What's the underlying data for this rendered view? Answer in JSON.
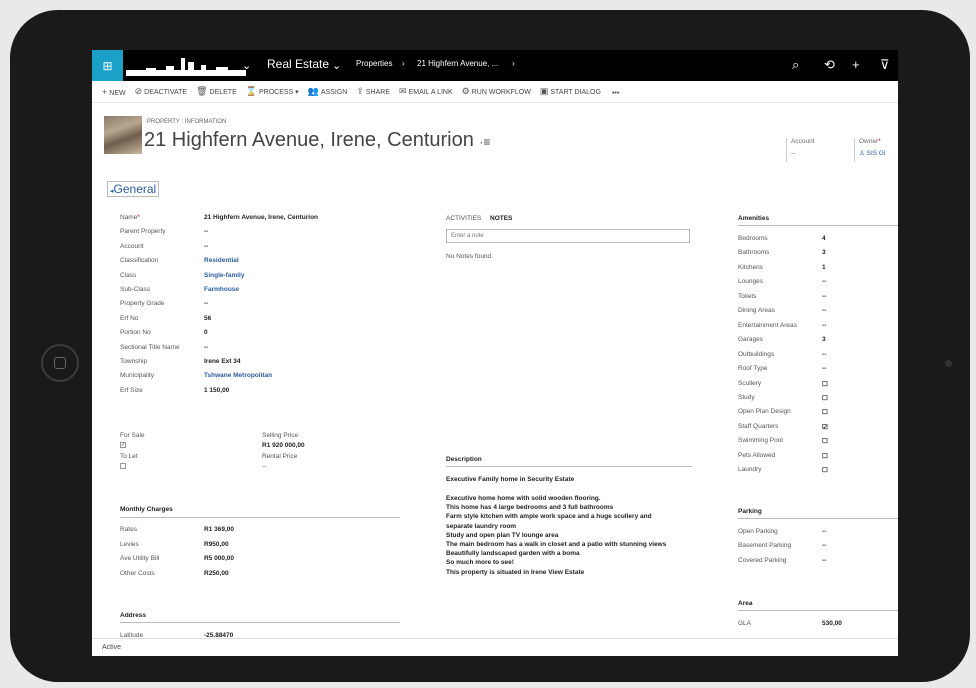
{
  "nav": {
    "app": "Real Estate",
    "crumb1": "Properties",
    "crumb2": "21 Highfern Avenue, ..."
  },
  "commands": [
    {
      "icon": "+",
      "label": "NEW"
    },
    {
      "icon": "⊘",
      "label": "DEACTIVATE"
    },
    {
      "icon": "🗑",
      "label": "DELETE"
    },
    {
      "icon": "⌛",
      "label": "PROCESS ▾"
    },
    {
      "icon": "👥",
      "label": "ASSIGN"
    },
    {
      "icon": "⇪",
      "label": "SHARE"
    },
    {
      "icon": "✉",
      "label": "EMAIL A LINK"
    },
    {
      "icon": "⚙",
      "label": "RUN WORKFLOW"
    },
    {
      "icon": "▣",
      "label": "START DIALOG"
    },
    {
      "icon": "",
      "label": "•••"
    }
  ],
  "header": {
    "entity": "PROPERTY : INFORMATION",
    "title": "21 Highfern Avenue, Irene, Centurion",
    "account_label": "Account",
    "account_value": "--",
    "owner_label": "Owner",
    "owner_value": "SIS Gl"
  },
  "section": "General",
  "left_labels": [
    "Name",
    "Parent Property",
    "Account",
    "Classification",
    "Class",
    "Sub-Class",
    "Property Grade",
    "Erf No",
    "Portion No",
    "Sectional Title Name",
    "Township",
    "Municipality",
    "Erf Size"
  ],
  "left_values": [
    "21 Highfern Avenue, Irene, Centurion",
    "--",
    "--",
    "Residential",
    "Single-family",
    "Farmhouse",
    "--",
    "56",
    "0",
    "--",
    "Irene Ext 34",
    "Tshwane Metropolitan",
    "1 150,00"
  ],
  "sale": {
    "for_sale": "For Sale",
    "to_let": "To Let",
    "selling_price_label": "Selling Price",
    "selling_price": "R1 920 000,00",
    "rental_price_label": "Rental Price",
    "rental_price": "--"
  },
  "monthly": {
    "title": "Monthly Charges",
    "labels": [
      "Rates",
      "Levies",
      "Ave Utility Bill",
      "Other Costs"
    ],
    "values": [
      "R1 369,00",
      "R950,00",
      "R5 000,00",
      "R250,00"
    ]
  },
  "address": {
    "title": "Address",
    "latitude_label": "Latitude",
    "latitude": "-25.88470"
  },
  "mid": {
    "activities": "ACTIVITIES",
    "notes": "NOTES",
    "note_placeholder": "Enter a note",
    "no_notes": "No Notes found."
  },
  "description": {
    "label": "Description",
    "headline": "Executive Family home in Security Estate",
    "lines": [
      "Executive home home with solid wooden flooring.",
      "This home has 4 large bedrooms and 3 full bathrooms",
      "Farm style kitchen with ample work space and a huge scullery and",
      "separate laundry room",
      "Study and open plan TV lounge area",
      "The main bedroom has a walk in closet and a patio with stunning views",
      "Beautifully landscaped garden with a boma",
      "So much more to see!",
      "This property is situated in Irene View Estate"
    ]
  },
  "amenities": {
    "title": "Amenities",
    "labels": [
      "Bedrooms",
      "Bathrooms",
      "Kitchens",
      "Lounges",
      "Toilets",
      "Dining Areas",
      "Entertainment Areas",
      "Garages",
      "Outbuildings",
      "Roof Type",
      "Scullery",
      "Study",
      "Open Plan Design",
      "Staff Quarters",
      "Swimming Pool",
      "Pets Allowed",
      "Laundry"
    ],
    "values": [
      "4",
      "3",
      "1",
      "--",
      "--",
      "--",
      "--",
      "3",
      "--",
      "--",
      "☐",
      "☐",
      "☐",
      "☑",
      "☐",
      "☐",
      "☐"
    ]
  },
  "parking": {
    "title": "Parking",
    "labels": [
      "Open Parking",
      "Basement Parking",
      "Covered Parking"
    ],
    "values": [
      "--",
      "--",
      "--"
    ]
  },
  "area": {
    "title": "Area",
    "gla_label": "GLA",
    "gla": "530,00"
  },
  "status": "Active",
  "colors": {
    "accent": "#2a5d9b",
    "tile": "#1ba1c8"
  }
}
